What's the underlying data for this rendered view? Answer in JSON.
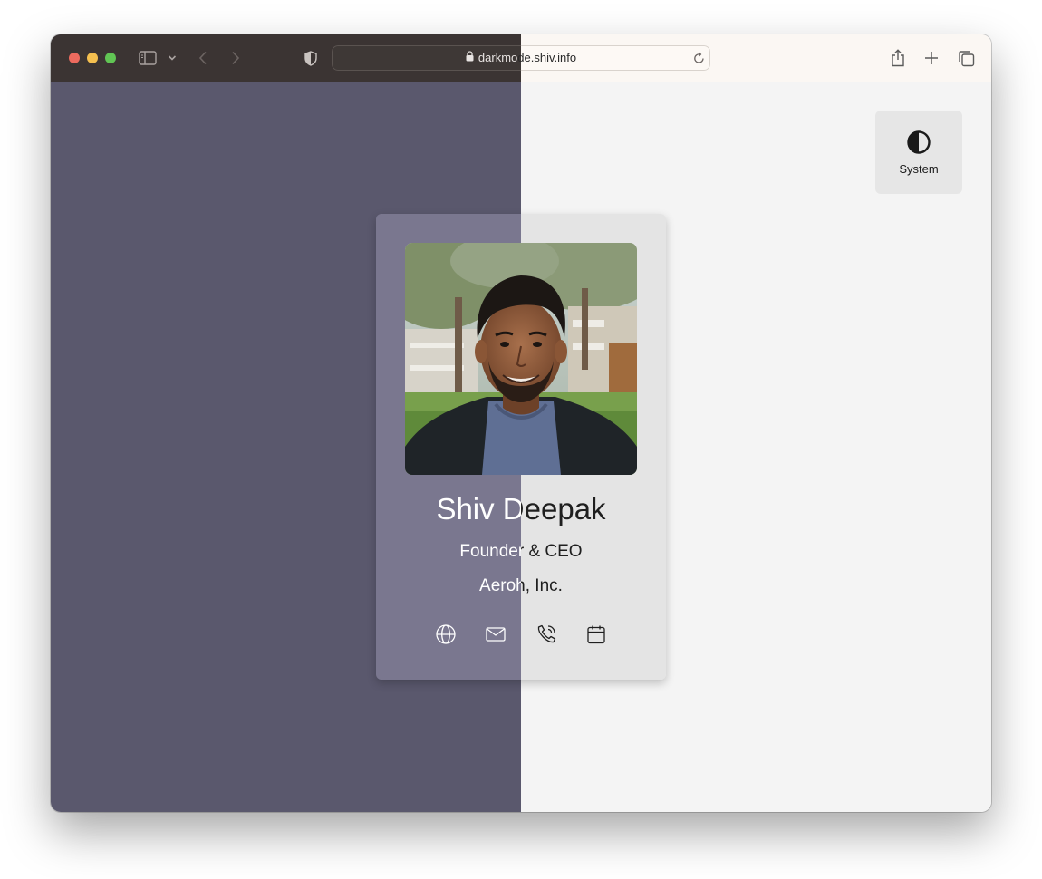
{
  "browser": {
    "url_prefix": "darkmo",
    "url_suffix": "de.shiv.info",
    "url_display": "darkmode.shiv.info",
    "icons": {
      "sidebar": "sidebar-icon",
      "chevron": "chevron-down-icon",
      "back": "back-icon",
      "forward": "forward-icon",
      "shield": "shield-icon",
      "lock": "lock-icon",
      "reload": "reload-icon",
      "share": "share-icon",
      "new_tab": "plus-icon",
      "tabs": "tab-overview-icon"
    }
  },
  "theme_toggle": {
    "label": "System",
    "icon": "half-circle-icon"
  },
  "card": {
    "name": "Shiv Deepak",
    "title": "Founder & CEO",
    "company": "Aeroh, Inc.",
    "icons": [
      "globe-icon",
      "mail-icon",
      "phone-icon",
      "calendar-icon"
    ]
  },
  "colors": {
    "dark_page": "#5a586d",
    "dark_card": "#7a778f",
    "light_page": "#f4f4f4",
    "light_card": "#e4e4e4",
    "dark_text": "#ffffff",
    "light_text": "#1f1f1f"
  }
}
